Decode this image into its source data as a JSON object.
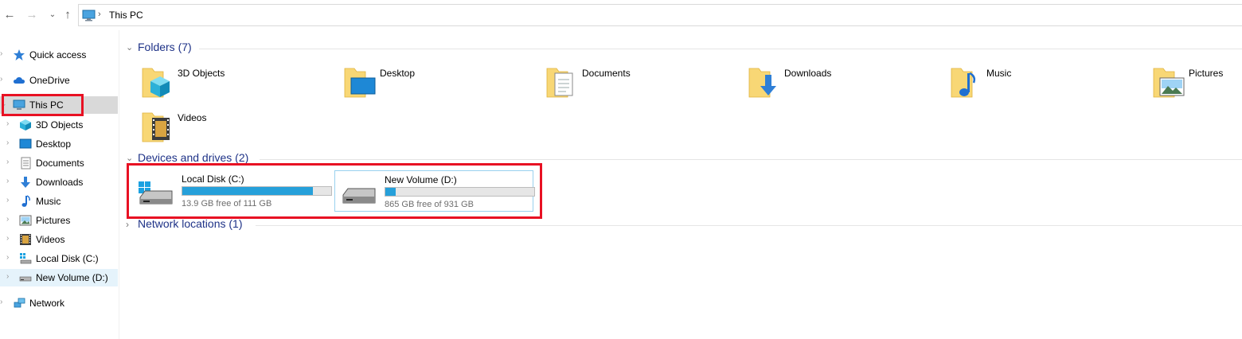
{
  "address": {
    "location": "This PC"
  },
  "sidebar": {
    "items": [
      {
        "label": "Quick access",
        "icon": "star-icon",
        "level": 0
      },
      {
        "label": "OneDrive",
        "icon": "cloud-icon",
        "level": 0
      },
      {
        "label": "This PC",
        "icon": "computer-icon",
        "level": 0,
        "expanded": true,
        "selected": true
      },
      {
        "label": "3D Objects",
        "icon": "cube-icon",
        "level": 1
      },
      {
        "label": "Desktop",
        "icon": "desktop-icon",
        "level": 1
      },
      {
        "label": "Documents",
        "icon": "document-icon",
        "level": 1
      },
      {
        "label": "Downloads",
        "icon": "download-arrow-icon",
        "level": 1
      },
      {
        "label": "Music",
        "icon": "music-note-icon",
        "level": 1
      },
      {
        "label": "Pictures",
        "icon": "picture-icon",
        "level": 1
      },
      {
        "label": "Videos",
        "icon": "film-icon",
        "level": 1
      },
      {
        "label": "Local Disk (C:)",
        "icon": "windows-drive-icon",
        "level": 1
      },
      {
        "label": "New Volume (D:)",
        "icon": "drive-icon",
        "level": 1,
        "highlighted": true
      },
      {
        "label": "Network",
        "icon": "network-icon",
        "level": 0
      }
    ]
  },
  "groups": {
    "folders": {
      "title": "Folders (7)",
      "items": [
        {
          "name": "3D Objects",
          "icon": "cube-icon"
        },
        {
          "name": "Desktop",
          "icon": "desktop-icon"
        },
        {
          "name": "Documents",
          "icon": "document-icon"
        },
        {
          "name": "Downloads",
          "icon": "download-arrow-icon"
        },
        {
          "name": "Music",
          "icon": "music-note-icon"
        },
        {
          "name": "Pictures",
          "icon": "picture-icon"
        },
        {
          "name": "Videos",
          "icon": "film-icon"
        }
      ]
    },
    "drives": {
      "title": "Devices and drives (2)",
      "items": [
        {
          "name": "Local Disk (C:)",
          "free": "13.9 GB free of 111 GB",
          "used_fraction": 0.875,
          "icon": "windows-drive-icon"
        },
        {
          "name": "New Volume (D:)",
          "free": "865 GB free of 931 GB",
          "used_fraction": 0.071,
          "icon": "drive-icon"
        }
      ]
    },
    "network": {
      "title": "Network locations (1)"
    }
  },
  "colors": {
    "accent": "#26a0da",
    "group_title": "#1e3287",
    "highlight_box": "#e81123",
    "folder_yellow": "#f8d775"
  }
}
